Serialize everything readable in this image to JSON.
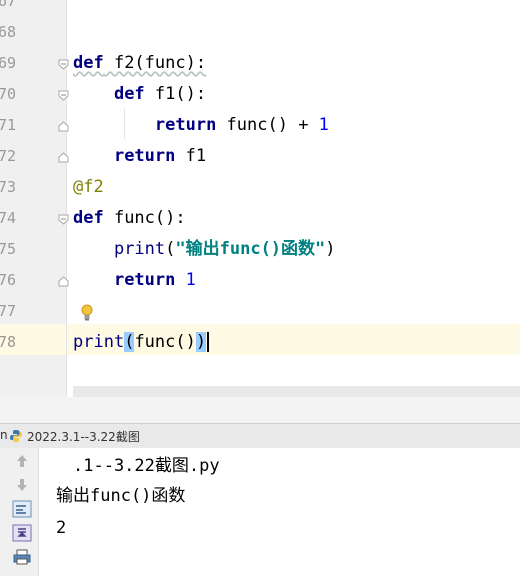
{
  "editor": {
    "line_numbers": [
      "67",
      "68",
      "69",
      "70",
      "71",
      "72",
      "73",
      "74",
      "75",
      "76",
      "77",
      "78"
    ],
    "lines": [
      {
        "parts": []
      },
      {
        "parts": []
      },
      {
        "parts": [
          {
            "t": "def",
            "c": "kw wavy"
          },
          {
            "t": " f2(func):",
            "c": "wavy"
          }
        ]
      },
      {
        "parts": [
          {
            "t": "    "
          },
          {
            "t": "def",
            "c": "kw"
          },
          {
            "t": " f1():"
          }
        ]
      },
      {
        "parts": [
          {
            "t": "        "
          },
          {
            "t": "return",
            "c": "kw"
          },
          {
            "t": " func() + "
          },
          {
            "t": "1",
            "c": "num"
          }
        ]
      },
      {
        "parts": [
          {
            "t": "    "
          },
          {
            "t": "return",
            "c": "kw"
          },
          {
            "t": " f1"
          }
        ]
      },
      {
        "parts": [
          {
            "t": "@f2",
            "c": "deco"
          }
        ]
      },
      {
        "parts": [
          {
            "t": "def",
            "c": "kw"
          },
          {
            "t": " func():"
          }
        ]
      },
      {
        "parts": [
          {
            "t": "    "
          },
          {
            "t": "print",
            "c": "builtin"
          },
          {
            "t": "("
          },
          {
            "t": "\"输出func()函数\"",
            "c": "str"
          },
          {
            "t": ")"
          }
        ]
      },
      {
        "parts": [
          {
            "t": "    "
          },
          {
            "t": "return",
            "c": "kw"
          },
          {
            "t": " "
          },
          {
            "t": "1",
            "c": "num"
          }
        ]
      },
      {
        "parts": []
      },
      {
        "parts": [
          {
            "t": "print",
            "c": "builtin"
          },
          {
            "t": "(",
            "c": "brace-hl"
          },
          {
            "t": "func()"
          },
          {
            "t": ")",
            "c": "brace-hl"
          }
        ]
      }
    ]
  },
  "run_tab": {
    "prefix": "n",
    "label": "2022.3.1--3.22截图"
  },
  "console": {
    "lines": [
      ".1--3.22截图.py",
      "输出func()函数",
      "2"
    ]
  },
  "icons": {
    "tab_icon": "python-file-icon",
    "toolbar": [
      "arrow-up-icon",
      "arrow-down-icon",
      "soft-wrap-icon",
      "scroll-to-end-icon",
      "print-icon"
    ]
  }
}
